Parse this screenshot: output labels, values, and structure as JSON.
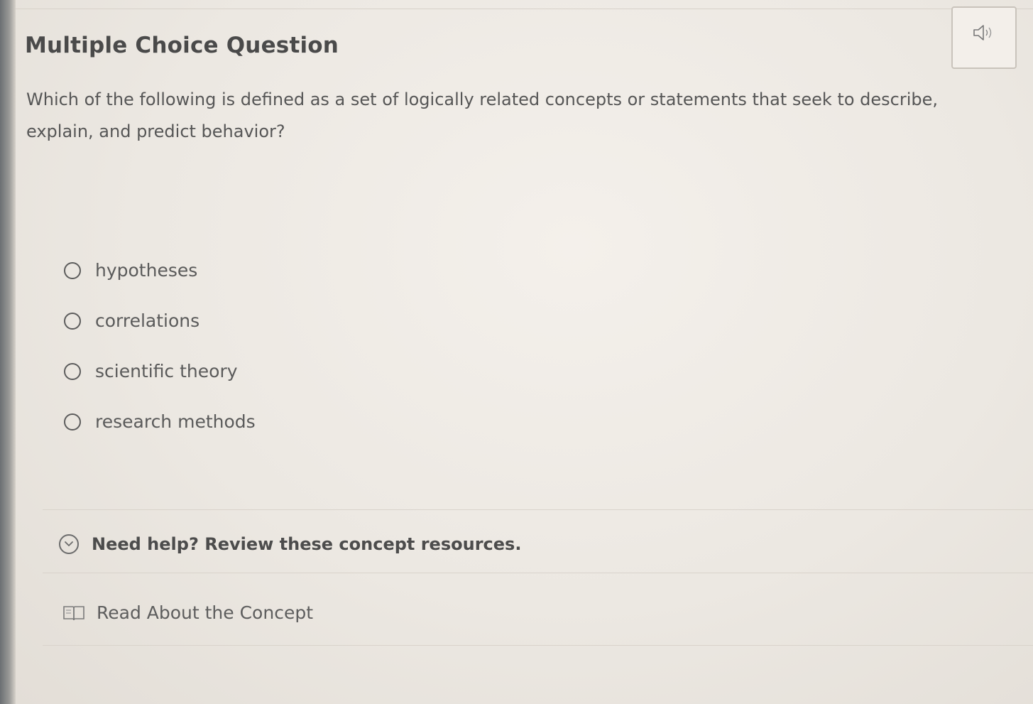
{
  "question": {
    "heading": "Multiple Choice Question",
    "text": "Which of the following is defined as a set of logically related concepts or statements that seek to describe, explain, and predict behavior?",
    "options": [
      {
        "label": "hypotheses"
      },
      {
        "label": "correlations"
      },
      {
        "label": "scientific theory"
      },
      {
        "label": "research methods"
      }
    ]
  },
  "audio": {
    "icon": "speaker-icon"
  },
  "help": {
    "label": "Need help? Review these concept resources.",
    "icon": "chevron-down-circle-icon"
  },
  "resources": [
    {
      "label": "Read About the Concept",
      "icon": "book-icon"
    }
  ]
}
